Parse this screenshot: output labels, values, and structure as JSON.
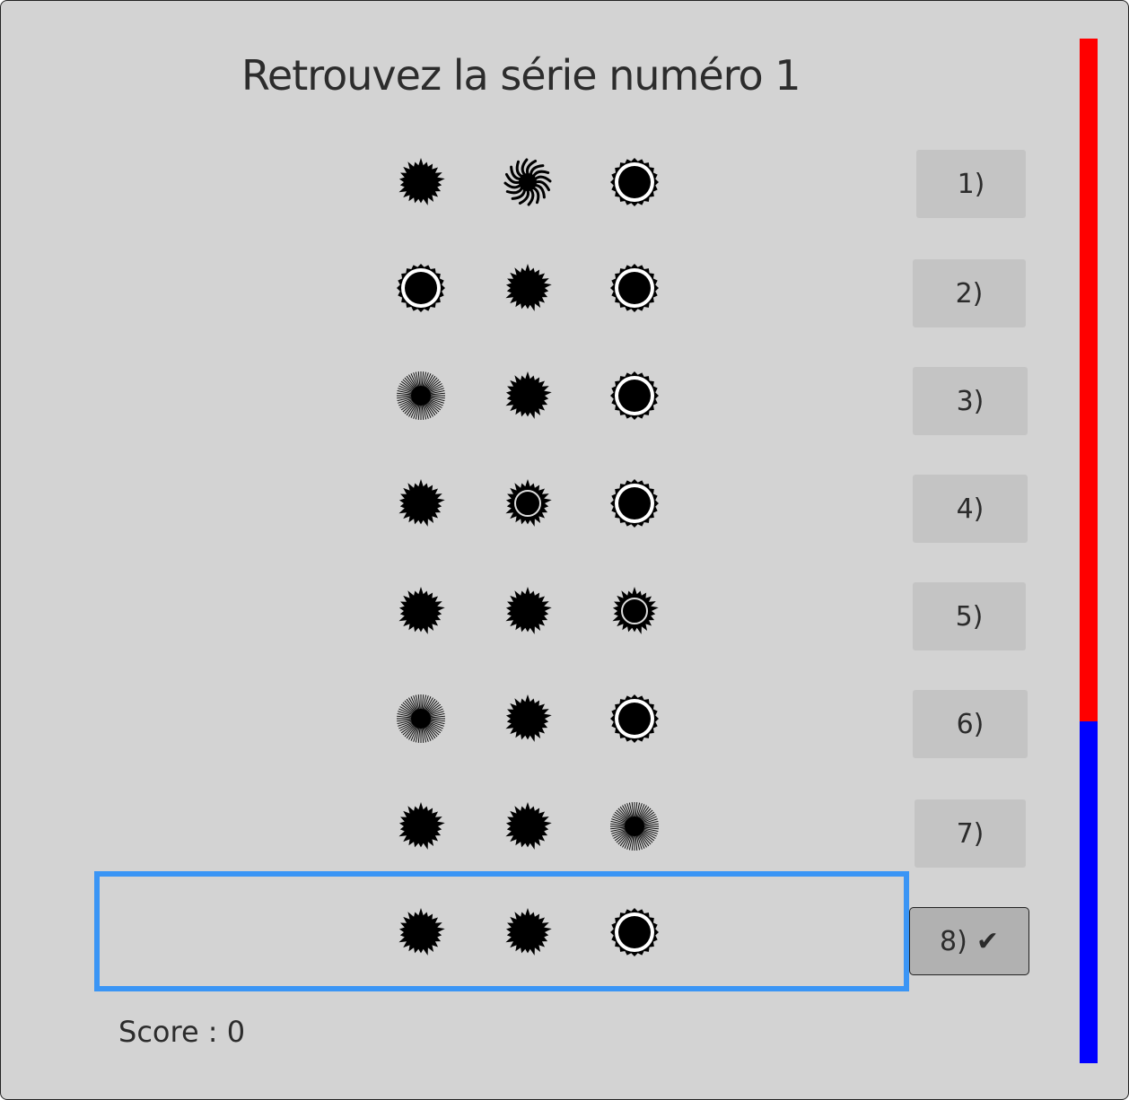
{
  "title": "Retrouvez la série numéro 1",
  "score_text": "Score : 0",
  "timer": {
    "elapsed_fraction": 0.666,
    "elapsed_color": "#ff0000",
    "remaining_color": "#0000ff"
  },
  "selected_option": 8,
  "options": [
    {
      "label": "1)",
      "checked": false,
      "symbols": [
        "spiky-sun-icon",
        "wavy-sun-icon",
        "ringed-sun-icon"
      ]
    },
    {
      "label": "2)",
      "checked": false,
      "symbols": [
        "ringed-sun-icon",
        "spiky-sun-icon",
        "ringed-sun-icon"
      ]
    },
    {
      "label": "3)",
      "checked": false,
      "symbols": [
        "rayed-sun-icon",
        "spiky-sun-icon",
        "ringed-sun-icon"
      ]
    },
    {
      "label": "4)",
      "checked": false,
      "symbols": [
        "spiky-sun-icon",
        "spiky-ring-sun-icon",
        "ringed-sun-icon"
      ]
    },
    {
      "label": "5)",
      "checked": false,
      "symbols": [
        "spiky-sun-icon",
        "spiky-sun-icon",
        "spiky-ring-sun-icon"
      ]
    },
    {
      "label": "6)",
      "checked": false,
      "symbols": [
        "rayed-sun-icon",
        "spiky-sun-icon",
        "ringed-sun-icon"
      ]
    },
    {
      "label": "7)",
      "checked": false,
      "symbols": [
        "spiky-sun-icon",
        "spiky-sun-icon",
        "rayed-sun-icon"
      ]
    },
    {
      "label": "8)",
      "checked": true,
      "checkmark": "✔",
      "symbols": [
        "spiky-sun-icon",
        "spiky-sun-icon",
        "ringed-sun-icon"
      ]
    }
  ]
}
